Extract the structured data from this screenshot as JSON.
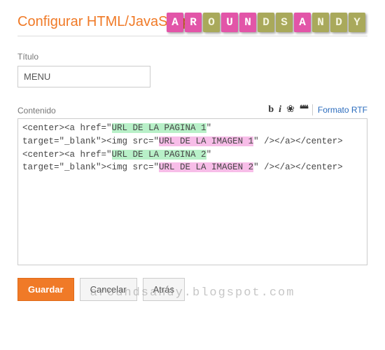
{
  "heading": "Configurar HTML/JavaScript",
  "title_label": "Título",
  "title_value": "MENU",
  "content_label": "Contenido",
  "toolbar": {
    "bold": "b",
    "italic": "i",
    "link": "❀",
    "quote": "❝❝",
    "rtf": "Formato RTF"
  },
  "code": {
    "l1a": "<center><a href=\"",
    "l1b": "URL DE LA PAGINA 1",
    "l1c": "\"",
    "l2a": "target=\"_blank\"><img src=\"",
    "l2b": "URL DE LA IMAGEN 1",
    "l2c": "\" /></a></center>",
    "l3a": "<center><a href=\"",
    "l3b": "URL DE LA PAGINA 2",
    "l3c": "\"",
    "l4a": "target=\"_blank\"><img src=\"",
    "l4b": "URL DE LA IMAGEN 2",
    "l4c": "\" /></a></center>"
  },
  "buttons": {
    "save": "Guardar",
    "cancel": "Cancelar",
    "back": "Atrás"
  },
  "logo": {
    "letters": [
      "A",
      "R",
      "O",
      "U",
      "N",
      "D",
      "S",
      "A",
      "N",
      "D",
      "Y"
    ],
    "colors": [
      "t-pink",
      "t-pink",
      "t-olive",
      "t-pink",
      "t-pink",
      "t-olive",
      "t-olive",
      "t-pink",
      "t-olive",
      "t-olive",
      "t-olive"
    ]
  },
  "watermark": "aroundsandy.blogspot.com"
}
